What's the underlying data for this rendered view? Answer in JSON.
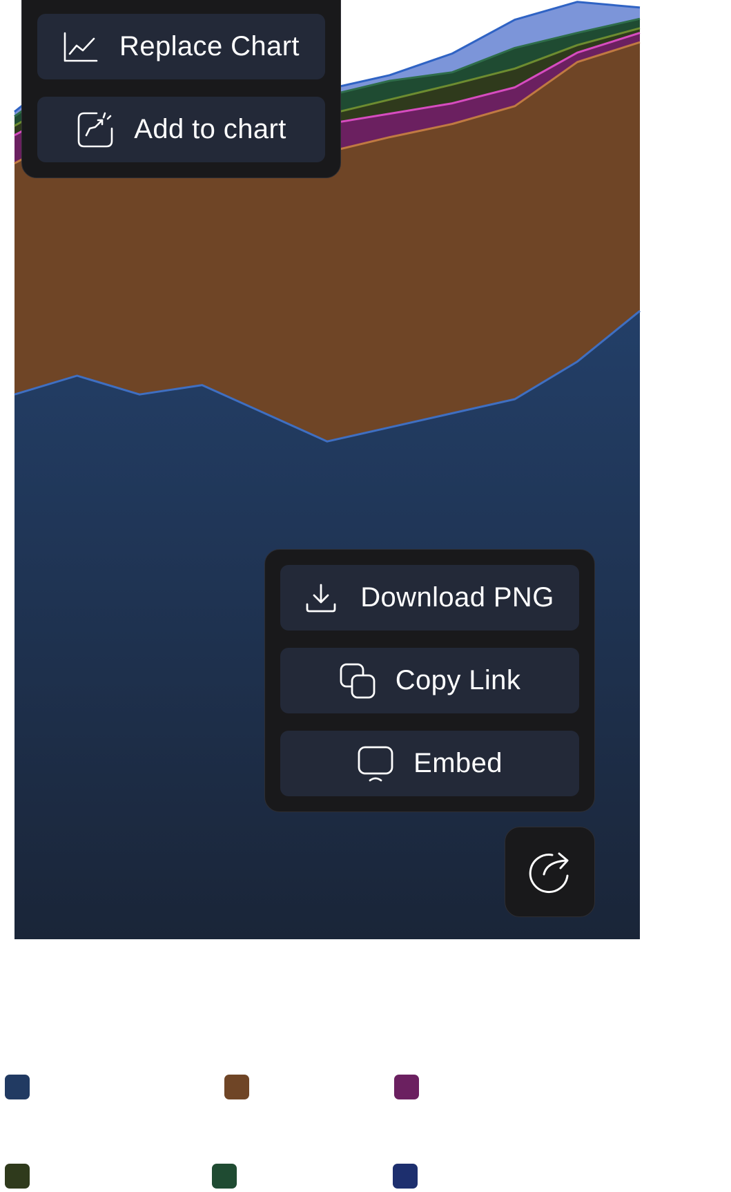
{
  "menu_top": {
    "replace_chart_label": "Replace Chart",
    "add_to_chart_label": "Add to chart"
  },
  "menu_share": {
    "download_png_label": "Download PNG",
    "copy_link_label": "Copy Link",
    "embed_label": "Embed"
  },
  "icons": {
    "replace_chart": "line-chart-icon",
    "add_to_chart": "add-to-chart-icon",
    "download": "download-icon",
    "copy": "copy-icon",
    "embed": "embed-icon",
    "share": "share-icon"
  },
  "chart_data": {
    "type": "area",
    "stacked": true,
    "x": [
      0,
      1,
      2,
      3,
      4,
      5,
      6,
      7,
      8,
      9,
      10
    ],
    "ylim": [
      0,
      100
    ],
    "grid": false,
    "series": [
      {
        "color": "#213a62",
        "line": "#3f6fc2",
        "values": [
          58.0,
          60.0,
          58.0,
          59.0,
          56.0,
          53.0,
          54.5,
          56.0,
          57.5,
          61.5,
          66.9
        ]
      },
      {
        "color": "#6f4526",
        "line": "#c07a42",
        "values": [
          24.6,
          26.2,
          24.6,
          25.4,
          29.8,
          30.8,
          30.9,
          30.8,
          31.2,
          31.9,
          28.6
        ]
      },
      {
        "color": "#6b2060",
        "line": "#d74cc0",
        "values": [
          3.0,
          3.0,
          3.0,
          3.0,
          3.0,
          3.0,
          2.5,
          2.2,
          2.0,
          1.0,
          1.0
        ]
      },
      {
        "color": "#2f3a1c",
        "line": "#6d8c30",
        "values": [
          1.0,
          1.2,
          5.0,
          1.0,
          1.0,
          1.0,
          1.5,
          2.0,
          2.0,
          0.8,
          0.5
        ]
      },
      {
        "color": "#1f4b32",
        "line": "#2f6d4a",
        "values": [
          1.0,
          2.0,
          2.0,
          2.0,
          1.5,
          2.0,
          2.0,
          1.3,
          2.2,
          1.3,
          1.0
        ]
      },
      {
        "color": "#7c95d9",
        "line": "#2f63c4",
        "values": [
          0.5,
          1.0,
          0.5,
          1.8,
          0.2,
          0.7,
          0.6,
          2.0,
          3.0,
          3.3,
          1.2
        ]
      }
    ]
  }
}
